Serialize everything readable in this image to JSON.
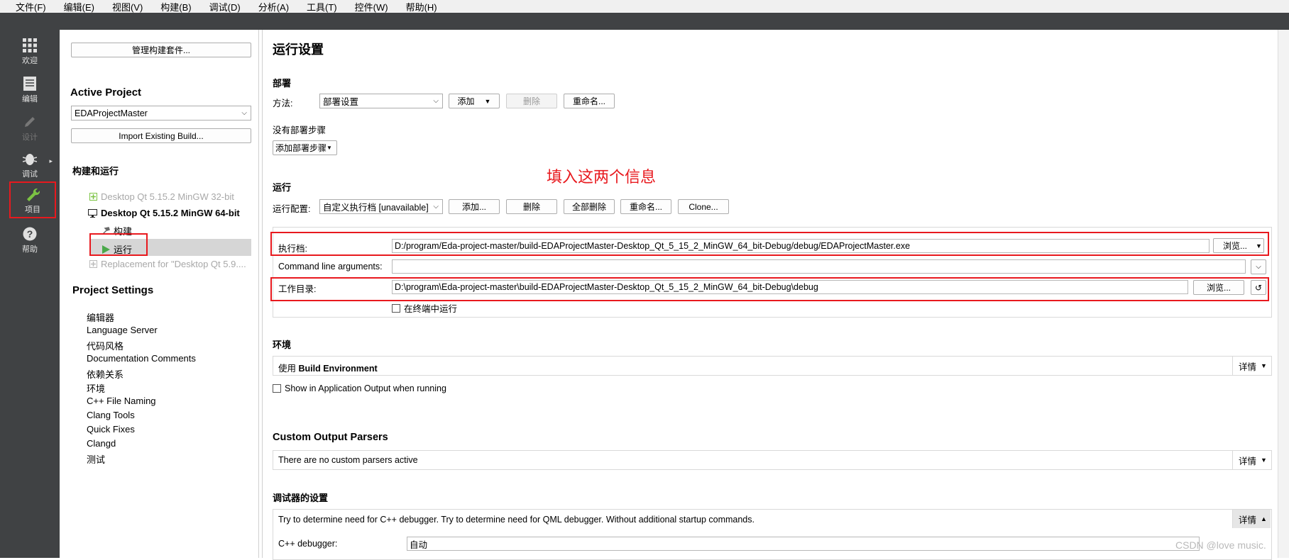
{
  "menubar": [
    "文件(F)",
    "编辑(E)",
    "视图(V)",
    "构建(B)",
    "调试(D)",
    "分析(A)",
    "工具(T)",
    "控件(W)",
    "帮助(H)"
  ],
  "modes": {
    "welcome": "欢迎",
    "edit": "编辑",
    "design": "设计",
    "debug": "调试",
    "projects": "项目",
    "help": "帮助"
  },
  "left": {
    "manage_kits": "管理构建套件...",
    "active_project_title": "Active Project",
    "project_name": "EDAProjectMaster",
    "import_build": "Import Existing Build...",
    "build_run_title": "构建和运行",
    "kits": {
      "kit32": "Desktop Qt 5.15.2 MinGW 32-bit",
      "kit64": "Desktop Qt 5.15.2 MinGW 64-bit",
      "build": "构建",
      "run": "运行",
      "replacement": "Replacement for \"Desktop Qt 5.9...."
    },
    "project_settings_title": "Project Settings",
    "settings": [
      "编辑器",
      "Language Server",
      "代码风格",
      "Documentation Comments",
      "依赖关系",
      "环境",
      "C++ File Naming",
      "Clang Tools",
      "Quick Fixes",
      "Clangd",
      "测试"
    ]
  },
  "main": {
    "title": "运行设置",
    "deploy": {
      "title": "部署",
      "method_label": "方法:",
      "method_value": "部署设置",
      "add": "添加",
      "remove": "删除",
      "rename": "重命名...",
      "no_steps": "没有部署步骤",
      "add_step": "添加部署步骤"
    },
    "run": {
      "title": "运行",
      "config_label": "运行配置:",
      "config_value": "自定义执行档 [unavailable]",
      "add": "添加...",
      "remove": "删除",
      "remove_all": "全部删除",
      "rename": "重命名...",
      "clone": "Clone...",
      "exe_label": "执行档:",
      "exe_value": "D:/program/Eda-project-master/build-EDAProjectMaster-Desktop_Qt_5_15_2_MinGW_64_bit-Debug/debug/EDAProjectMaster.exe",
      "browse": "浏览...",
      "args_label": "Command line arguments:",
      "args_value": "",
      "workdir_label": "工作目录:",
      "workdir_value": "D:\\program\\Eda-project-master\\build-EDAProjectMaster-Desktop_Qt_5_15_2_MinGW_64_bit-Debug\\debug",
      "browse2": "浏览...",
      "run_in_terminal": "在终端中运行"
    },
    "env": {
      "title": "环境",
      "use_prefix": "使用",
      "use_value": "Build Environment",
      "details": "详情",
      "show_output": "Show in Application Output when running"
    },
    "parsers": {
      "title": "Custom Output Parsers",
      "text": "There are no custom parsers active",
      "details": "详情"
    },
    "debugger": {
      "title": "调试器的设置",
      "text": "Try to determine need for C++ debugger. Try to determine need for QML debugger. Without additional startup commands.",
      "details": "详情",
      "cpp_label": "C++ debugger:",
      "cpp_value": "自动"
    }
  },
  "annotation": "填入这两个信息",
  "watermark": "CSDN @love music."
}
